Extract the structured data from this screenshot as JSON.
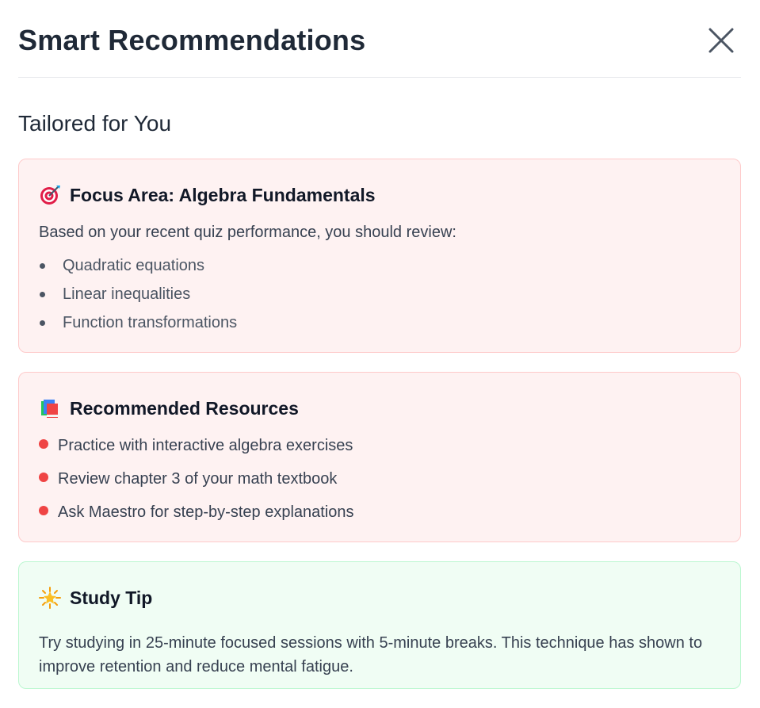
{
  "header": {
    "title": "Smart Recommendations"
  },
  "section": {
    "subtitle": "Tailored for You"
  },
  "focus_card": {
    "icon": "target-icon",
    "title": "Focus Area: Algebra Fundamentals",
    "intro": "Based on your recent quiz performance, you should review:",
    "items": [
      "Quadratic equations",
      "Linear inequalities",
      "Function transformations"
    ]
  },
  "resources_card": {
    "icon": "books-icon",
    "title": "Recommended Resources",
    "items": [
      "Practice with interactive algebra exercises",
      "Review chapter 3 of your math textbook",
      "Ask Maestro for step-by-step explanations"
    ]
  },
  "tip_card": {
    "icon": "star-icon",
    "title": "Study Tip",
    "text": "Try studying in 25-minute focused sessions with 5-minute breaks. This technique has shown to improve retention and reduce mental fatigue."
  },
  "colors": {
    "red_card_bg": "#fef2f2",
    "red_card_border": "#fecaca",
    "bullet_red": "#ef4444",
    "green_card_bg": "#f0fdf4",
    "green_card_border": "#bbf7d0"
  }
}
